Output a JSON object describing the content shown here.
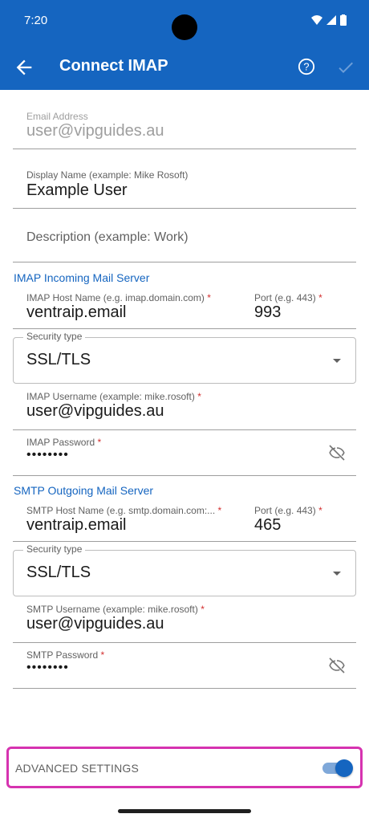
{
  "status": {
    "time": "7:20"
  },
  "appbar": {
    "title": "Connect IMAP"
  },
  "account": {
    "email_label": "Email Address",
    "email_value": "user@vipguides.au",
    "display_label": "Display Name (example: Mike Rosoft)",
    "display_value": "Example User",
    "description_placeholder": "Description (example: Work)"
  },
  "imap": {
    "section": "IMAP Incoming Mail Server",
    "host_label": "IMAP Host Name (e.g. imap.domain.com)",
    "host_value": "ventraip.email",
    "port_label": "Port (e.g. 443)",
    "port_value": "993",
    "security_label": "Security type",
    "security_value": "SSL/TLS",
    "username_label": "IMAP Username (example: mike.rosoft)",
    "username_value": "user@vipguides.au",
    "password_label": "IMAP Password",
    "password_value": "••••••••"
  },
  "smtp": {
    "section": "SMTP Outgoing Mail Server",
    "host_label": "SMTP Host Name (e.g. smtp.domain.com:...",
    "host_value": "ventraip.email",
    "port_label": "Port (e.g. 443)",
    "port_value": "465",
    "security_label": "Security type",
    "security_value": "SSL/TLS",
    "username_label": "SMTP Username (example: mike.rosoft)",
    "username_value": "user@vipguides.au",
    "password_label": "SMTP Password",
    "password_value": "••••••••"
  },
  "advanced": {
    "label": "ADVANCED SETTINGS",
    "enabled": true
  },
  "required_marker": "*",
  "colors": {
    "primary": "#1565c0",
    "required": "#d32f2f",
    "highlight": "#d633b0"
  },
  "icons": [
    "back-arrow-icon",
    "help-icon",
    "check-icon",
    "eye-off-icon",
    "dropdown-caret-icon",
    "wifi-icon",
    "signal-icon",
    "battery-icon"
  ]
}
